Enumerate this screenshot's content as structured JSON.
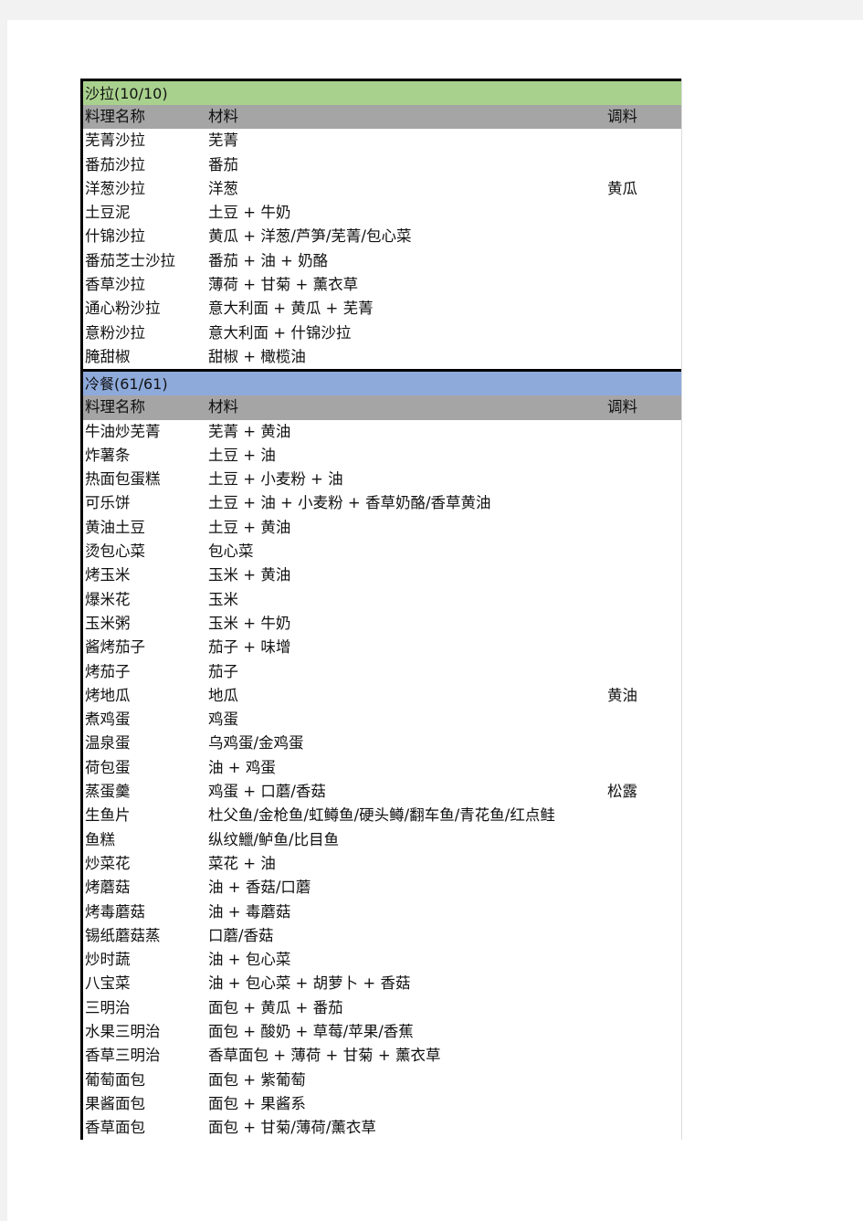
{
  "sections": [
    {
      "title": "沙拉(10/10)",
      "color": "#a9d18e",
      "headers": [
        "料理名称",
        "材料",
        "调料"
      ],
      "rows": [
        [
          "芜菁沙拉",
          "芜菁",
          ""
        ],
        [
          "番茄沙拉",
          "番茄",
          ""
        ],
        [
          "洋葱沙拉",
          "洋葱",
          "黄瓜"
        ],
        [
          "土豆泥",
          "土豆 + 牛奶",
          ""
        ],
        [
          "什锦沙拉",
          "黄瓜 + 洋葱/芦笋/芜菁/包心菜",
          ""
        ],
        [
          "番茄芝士沙拉",
          "番茄 + 油 + 奶酪",
          ""
        ],
        [
          "香草沙拉",
          "薄荷 + 甘菊 + 薰衣草",
          ""
        ],
        [
          "通心粉沙拉",
          "意大利面 + 黄瓜 + 芜菁",
          ""
        ],
        [
          "意粉沙拉",
          "意大利面 + 什锦沙拉",
          ""
        ],
        [
          "腌甜椒",
          "甜椒 + 橄榄油",
          ""
        ]
      ]
    },
    {
      "title": "冷餐(61/61)",
      "color": "#8eaadb",
      "headers": [
        "料理名称",
        "材料",
        "调料"
      ],
      "rows": [
        [
          "牛油炒芜菁",
          "芜菁 + 黄油",
          ""
        ],
        [
          "炸薯条",
          "土豆 + 油",
          ""
        ],
        [
          "热面包蛋糕",
          "土豆 + 小麦粉 + 油",
          ""
        ],
        [
          "可乐饼",
          "土豆 + 油 + 小麦粉 + 香草奶酪/香草黄油",
          ""
        ],
        [
          "黄油土豆",
          "土豆 + 黄油",
          ""
        ],
        [
          "烫包心菜",
          "包心菜",
          ""
        ],
        [
          "烤玉米",
          "玉米 + 黄油",
          ""
        ],
        [
          "爆米花",
          "玉米",
          ""
        ],
        [
          "玉米粥",
          "玉米 + 牛奶",
          ""
        ],
        [
          "酱烤茄子",
          "茄子 + 味增",
          ""
        ],
        [
          "烤茄子",
          "茄子",
          ""
        ],
        [
          "烤地瓜",
          "地瓜",
          "黄油"
        ],
        [
          "煮鸡蛋",
          "鸡蛋",
          ""
        ],
        [
          "温泉蛋",
          "乌鸡蛋/金鸡蛋",
          ""
        ],
        [
          "荷包蛋",
          "油 + 鸡蛋",
          ""
        ],
        [
          "蒸蛋羹",
          "鸡蛋 + 口蘑/香菇",
          "松露"
        ],
        [
          "生鱼片",
          "杜父鱼/金枪鱼/虹鳟鱼/硬头鳟/翻车鱼/青花鱼/红点鲑",
          ""
        ],
        [
          "鱼糕",
          "纵纹鱲/鲈鱼/比目鱼",
          ""
        ],
        [
          "炒菜花",
          "菜花 + 油",
          ""
        ],
        [
          "烤蘑菇",
          "油 + 香菇/口蘑",
          ""
        ],
        [
          "烤毒蘑菇",
          "油 + 毒蘑菇",
          ""
        ],
        [
          "锡纸蘑菇蒸",
          "口蘑/香菇",
          ""
        ],
        [
          "炒时蔬",
          "油 + 包心菜",
          ""
        ],
        [
          "八宝菜",
          "油 + 包心菜 + 胡萝卜 + 香菇",
          ""
        ],
        [
          "三明治",
          "面包 + 黄瓜 + 番茄",
          ""
        ],
        [
          "水果三明治",
          "面包 + 酸奶 + 草莓/苹果/香蕉",
          ""
        ],
        [
          "香草三明治",
          "香草面包 + 薄荷 + 甘菊 + 薰衣草",
          ""
        ],
        [
          "葡萄面包",
          "面包 + 紫葡萄",
          ""
        ],
        [
          "果酱面包",
          "面包 + 果酱系",
          ""
        ],
        [
          "香草面包",
          "面包 + 甘菊/薄荷/薰衣草",
          ""
        ]
      ]
    }
  ]
}
